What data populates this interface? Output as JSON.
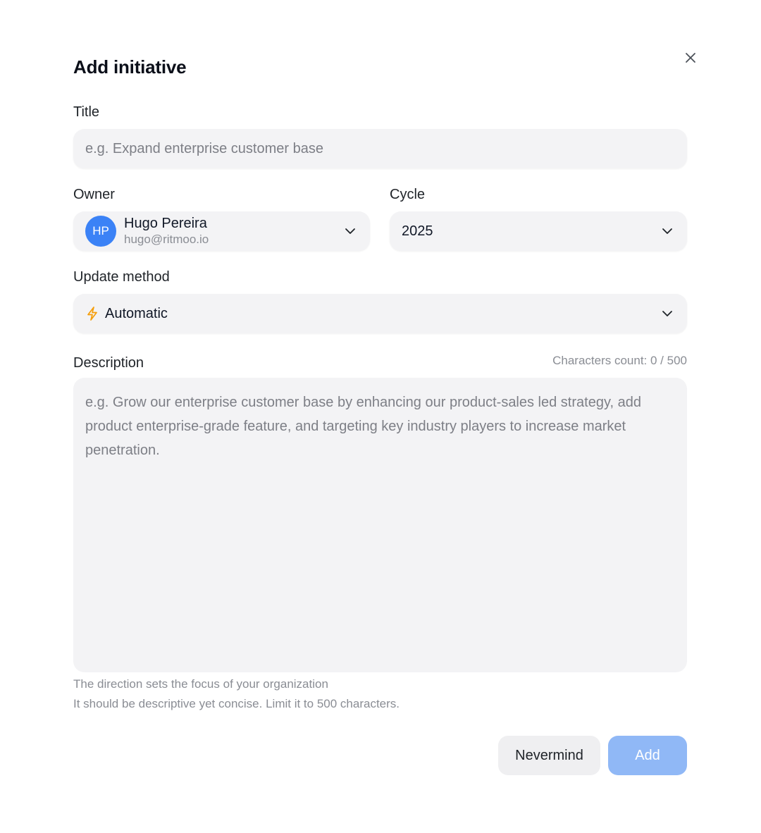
{
  "dialog": {
    "title": "Add initiative"
  },
  "title_field": {
    "label": "Title",
    "placeholder": "e.g. Expand enterprise customer base"
  },
  "owner": {
    "label": "Owner",
    "initials": "HP",
    "name": "Hugo Pereira",
    "email": "hugo@ritmoo.io",
    "avatar_color": "#3b82f6"
  },
  "cycle": {
    "label": "Cycle",
    "value": "2025"
  },
  "update_method": {
    "label": "Update method",
    "value": "Automatic",
    "icon": "lightning-bolt-icon",
    "icon_color": "#f59e0b"
  },
  "description": {
    "label": "Description",
    "char_count": "Characters count: 0 / 500",
    "placeholder": "e.g. Grow our enterprise customer base by enhancing our product-sales led strategy, add product enterprise-grade feature, and targeting key industry players to increase market penetration.",
    "hint_line1": "The direction sets the focus of your organization",
    "hint_line2": "It should be descriptive yet concise. Limit it to 500 characters."
  },
  "actions": {
    "cancel_label": "Nevermind",
    "submit_label": "Add",
    "submit_color": "#90b8f6"
  }
}
